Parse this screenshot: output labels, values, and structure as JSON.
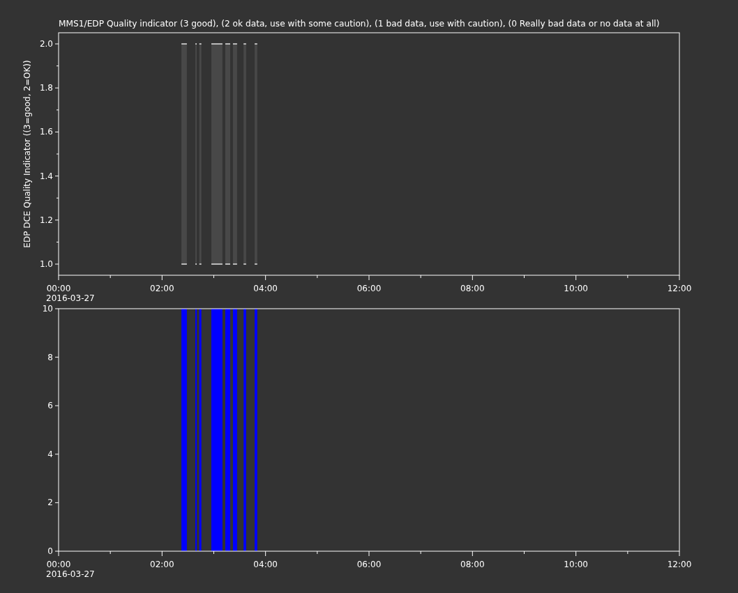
{
  "title": "MMS1/EDP  Quality indicator (3 good), (2 ok data, use with some caution), (1 bad data, use with caution), (0 Really bad data or no data at all)",
  "panels": [
    {
      "kind": "quality_strip",
      "minor_yticks": true,
      "date_label": "2016-03-27",
      "ylabel": "EDP DCE Quality Indicator ((3=good, 2=OK))",
      "xticks": [
        "00:00",
        "02:00",
        "04:00",
        "06:00",
        "08:00",
        "10:00",
        "12:00"
      ],
      "yticks": [
        "2.0",
        "1.8",
        "1.6",
        "1.4",
        "1.2",
        "1.0"
      ]
    },
    {
      "kind": "chart",
      "minor_yticks": false,
      "date_label": "2016-03-27",
      "chart_data": {
        "type": "bar",
        "x": [
          2.427,
          2.657,
          2.74,
          3.06,
          3.27,
          3.41,
          3.6,
          3.815
        ],
        "series": [
          {
            "color": "#0000ff",
            "values": [
              10,
              10,
              10,
              10,
              10,
              10,
              10,
              10
            ]
          }
        ],
        "xlim": [
          0,
          12
        ],
        "ylim": [
          0,
          10
        ],
        "xticks": [
          {
            "value": 0,
            "label": "00:00"
          },
          {
            "value": 2,
            "label": "02:00"
          },
          {
            "value": 4,
            "label": "04:00"
          },
          {
            "value": 6,
            "label": "06:00"
          },
          {
            "value": 8,
            "label": "08:00"
          },
          {
            "value": 10,
            "label": "10:00"
          },
          {
            "value": 12,
            "label": "12:00"
          }
        ],
        "yticks": [
          {
            "value": 0,
            "label": "0"
          },
          {
            "value": 2,
            "label": "2"
          },
          {
            "value": 4,
            "label": "4"
          },
          {
            "value": 6,
            "label": "6"
          },
          {
            "value": 8,
            "label": "8"
          },
          {
            "value": 10,
            "label": "10"
          }
        ]
      }
    }
  ]
}
